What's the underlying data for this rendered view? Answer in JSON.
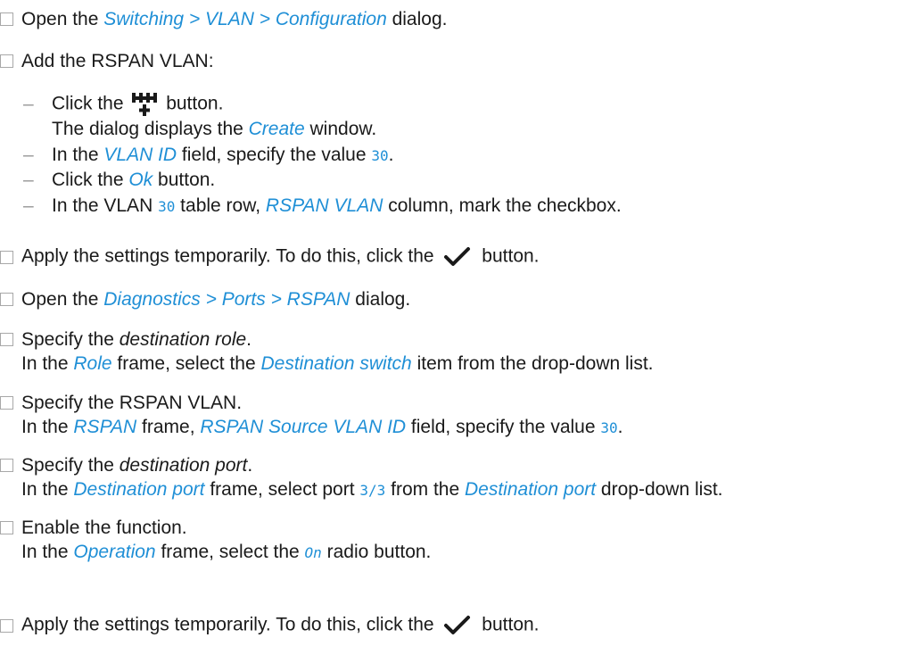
{
  "steps": [
    {
      "parts": [
        "Open the ",
        "Switching > VLAN > Configuration",
        " dialog."
      ]
    },
    {
      "text": "Add the RSPAN VLAN:",
      "sub": [
        {
          "a": "Click the ",
          "b": " button."
        },
        {
          "a": "The dialog displays the ",
          "ref": "Create",
          "b": " window."
        },
        {
          "a": "In the ",
          "ref": "VLAN ID",
          "b": " field, specify the value ",
          "val": "30",
          "c": "."
        },
        {
          "a": "Click the ",
          "ref": "Ok",
          "b": " button."
        },
        {
          "a": "In the VLAN ",
          "val": "30",
          "b": " table row, ",
          "ref": "RSPAN VLAN",
          "c": " column, mark the checkbox."
        }
      ]
    },
    {
      "a": "Apply the settings temporarily. To do this, click the ",
      "b": " button."
    },
    {
      "parts": [
        "Open the ",
        "Diagnostics > Ports > RSPAN",
        " dialog."
      ]
    },
    {
      "l1a": "Specify the ",
      "l1i": "destination role",
      "l1b": ".",
      "l2a": "In the ",
      "l2r": "Role",
      "l2b": " frame, select the ",
      "l2r2": "Destination switch",
      "l2c": " item from the drop-down list."
    },
    {
      "l1": "Specify the RSPAN VLAN.",
      "l2a": "In the ",
      "l2r": "RSPAN",
      "l2b": " frame, ",
      "l2r2": "RSPAN Source VLAN ID",
      "l2c": " field, specify the value ",
      "l2v": "30",
      "l2d": "."
    },
    {
      "l1a": "Specify the ",
      "l1i": "destination port",
      "l1b": ".",
      "l2a": "In the ",
      "l2r": "Destination port",
      "l2b": " frame, select port ",
      "l2v": "3/3",
      "l2c": " from the ",
      "l2r2": "Destination port",
      "l2d": " drop-down list."
    },
    {
      "l1": "Enable the function.",
      "l2a": "In the ",
      "l2r": "Operation",
      "l2b": " frame, select the ",
      "l2v": "On",
      "l2c": " radio button."
    },
    {
      "a": "Apply the settings temporarily. To do this, click the ",
      "b": " button."
    }
  ],
  "icons": {
    "add": "add-vlan-icon",
    "apply": "checkmark-icon"
  }
}
